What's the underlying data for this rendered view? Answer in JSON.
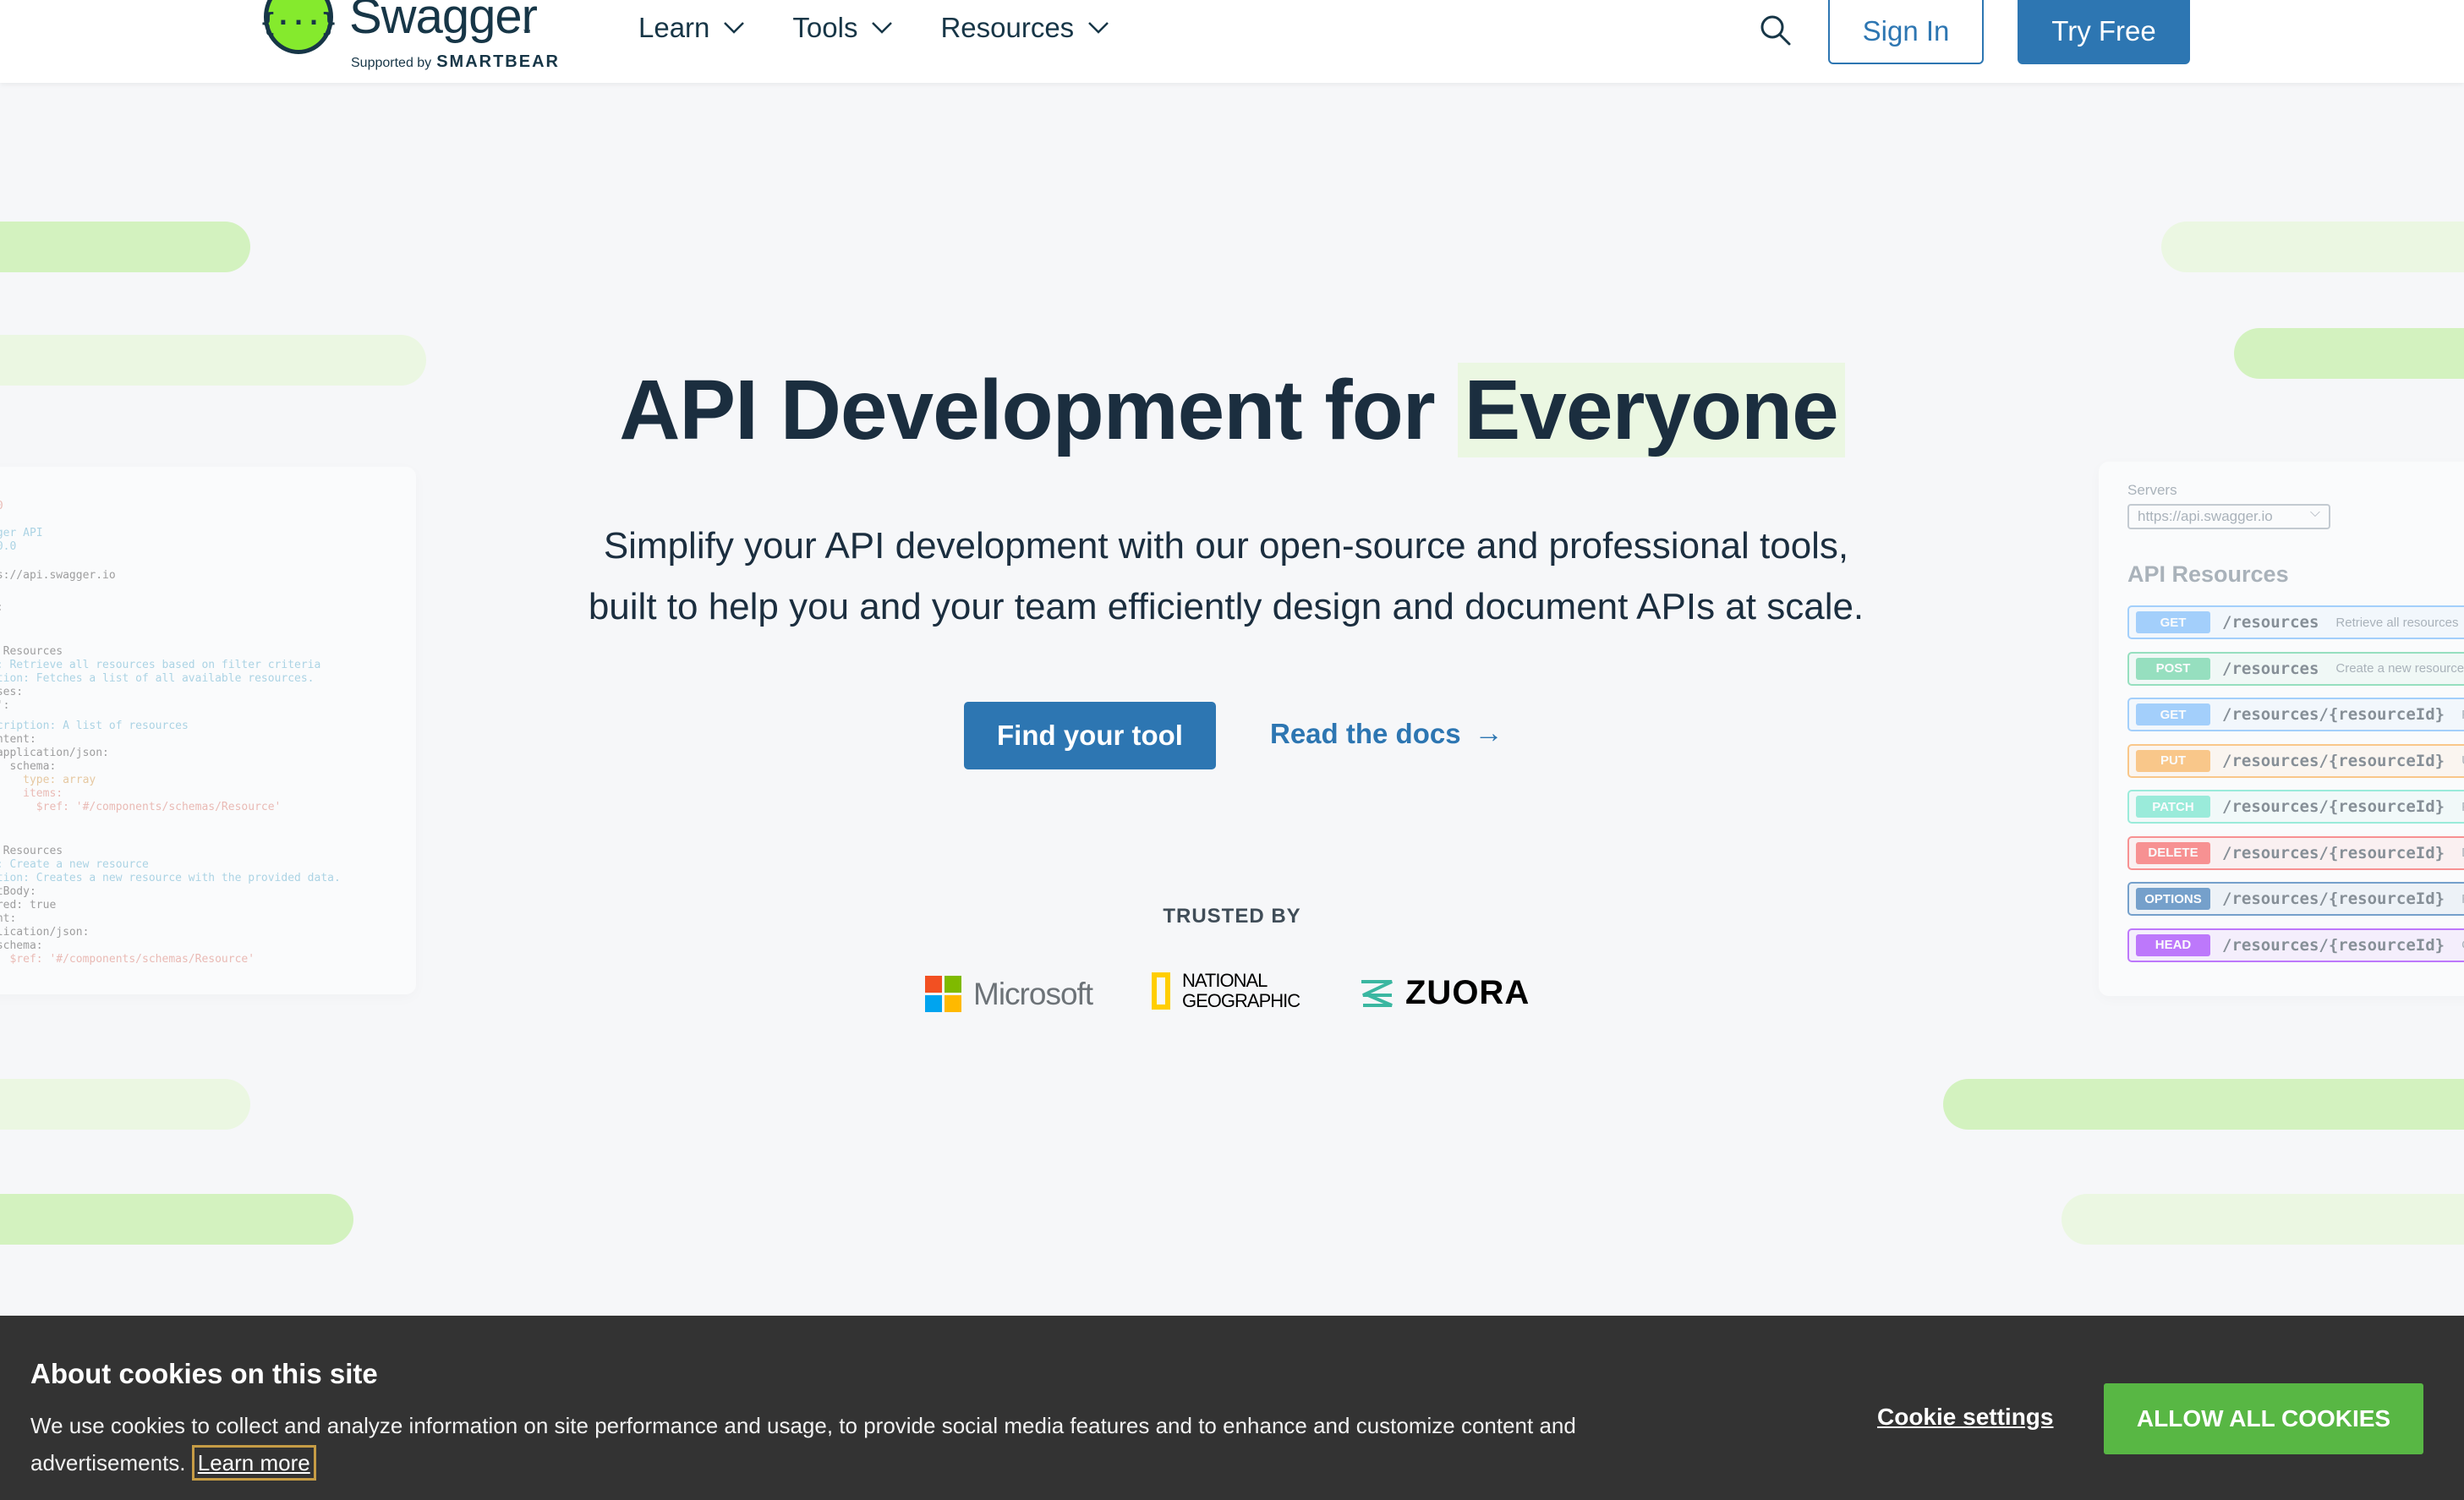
{
  "header": {
    "logo_text": "Swagger",
    "logo_tm": "™",
    "logo_mark": "{···}",
    "supported_by": "Supported by",
    "smartbear": "SMARTBEAR",
    "nav": [
      {
        "label": "Learn"
      },
      {
        "label": "Tools"
      },
      {
        "label": "Resources"
      }
    ],
    "sign_in": "Sign In",
    "try_free": "Try Free"
  },
  "hero": {
    "title_part1": "API Development for",
    "title_highlight": "Everyone",
    "subtitle_line1": "Simplify your API development with our open-source and professional tools,",
    "subtitle_line2": "built to help you and your team efficiently design and document APIs at scale.",
    "primary_cta": "Find your tool",
    "secondary_cta": "Read the docs",
    "secondary_arrow": "→",
    "trusted_by": "TRUSTED BY",
    "logos": {
      "microsoft": "Microsoft",
      "natgeo_line1": "NATIONAL",
      "natgeo_line2": "GEOGRAPHIC",
      "zuora": "ZUORA"
    }
  },
  "left_panel": {
    "code_lines": [
      {
        "text": ".0",
        "color": "#e08a7e"
      },
      {
        "text": "gger API",
        "color": "#6fb7d4"
      },
      {
        "text": ".0.0",
        "color": "#6fb7d4"
      },
      {
        "text": "ps://api.swagger.io",
        "color": "#555555"
      },
      {
        "text": "s:",
        "color": "#555555"
      },
      {
        "text": "I Resources",
        "color": "#555555"
      },
      {
        "text": "y: Retrieve all resources based on filter criteria",
        "color": "#6fb7d4"
      },
      {
        "text": "ption: Fetches a list of all available resources.",
        "color": "#6fb7d4"
      },
      {
        "text": "nses:",
        "color": "#555555"
      },
      {
        "text": "0':",
        "color": "#555555"
      },
      {
        "text": "scription: A list of resources",
        "color": "#6fb7d4"
      },
      {
        "text": "ontent:",
        "color": "#555555"
      },
      {
        "text": " application/json:",
        "color": "#555555"
      },
      {
        "text": "   schema:",
        "color": "#555555"
      },
      {
        "text": "     type: array",
        "color": "#d9a35a"
      },
      {
        "text": "     items:",
        "color": "#e08a7e"
      },
      {
        "text": "       $ref: '#/components/schemas/Resource'",
        "color": "#e08a7e"
      },
      {
        "text": "I Resources",
        "color": "#555555"
      },
      {
        "text": "y: Create a new resource",
        "color": "#6fb7d4"
      },
      {
        "text": "ption: Creates a new resource with the provided data.",
        "color": "#6fb7d4"
      },
      {
        "text": "stBody:",
        "color": "#555555"
      },
      {
        "text": "ired: true",
        "color": "#555555"
      },
      {
        "text": "ent:",
        "color": "#555555"
      },
      {
        "text": "plication/json:",
        "color": "#555555"
      },
      {
        "text": " schema:",
        "color": "#555555"
      },
      {
        "text": "   $ref: '#/components/schemas/Resource'",
        "color": "#e08a7e"
      }
    ]
  },
  "right_panel": {
    "servers_label": "Servers",
    "server_value": "https://api.swagger.io",
    "resources_title": "API Resources",
    "operations": [
      {
        "method": "GET",
        "path": "/resources",
        "desc": "Retrieve all resources",
        "color": "#61affe"
      },
      {
        "method": "POST",
        "path": "/resources",
        "desc": "Create a new resource",
        "color": "#49cc90"
      },
      {
        "method": "GET",
        "path": "/resources/{resourceId}",
        "desc": "R",
        "color": "#61affe"
      },
      {
        "method": "PUT",
        "path": "/resources/{resourceId}",
        "desc": "U",
        "color": "#fca130"
      },
      {
        "method": "PATCH",
        "path": "/resources/{resourceId}",
        "desc": "P",
        "color": "#50e3c2"
      },
      {
        "method": "DELETE",
        "path": "/resources/{resourceId}",
        "desc": "D",
        "color": "#f93e3e"
      },
      {
        "method": "OPTIONS",
        "path": "/resources/{resourceId}",
        "desc": "R",
        "color": "#0d5aa7"
      },
      {
        "method": "HEAD",
        "path": "/resources/{resourceId}",
        "desc": "C",
        "color": "#9012fe"
      }
    ]
  },
  "cookie": {
    "title": "About cookies on this site",
    "text": "We use cookies to collect and analyze information on site performance and usage, to provide social media features and to enhance and customize content and advertisements.",
    "learn_more": "Learn more",
    "settings": "Cookie settings",
    "allow_all": "ALLOW ALL COOKIES"
  },
  "colors": {
    "brand_green": "#85ea2d",
    "brand_dark": "#173647",
    "primary_blue": "#2d76b2",
    "cookie_bg": "#333333",
    "cookie_allow": "#58b744",
    "highlight": "#ebf7e2"
  },
  "icons": {
    "search": "search-icon",
    "chevron": "chevron-down-icon",
    "arrow": "arrow-right-icon"
  }
}
